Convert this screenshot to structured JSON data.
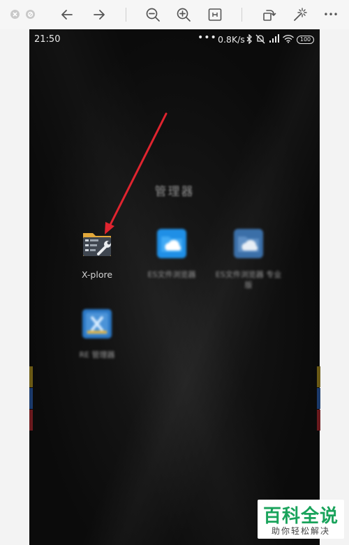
{
  "toolbar": {
    "icons": [
      "close-icon",
      "minimize-icon",
      "back-arrow-icon",
      "forward-arrow-icon",
      "zoom-out-icon",
      "zoom-in-icon",
      "fit-to-window-icon",
      "rotate-icon",
      "magic-wand-icon",
      "more-icon"
    ],
    "more_label": "•••"
  },
  "statusbar": {
    "time": "21:50",
    "more": "•••",
    "speed": "0.8K/s",
    "battery": "100"
  },
  "folder": {
    "title": "管理器",
    "apps": [
      {
        "label": "X-plore",
        "icon": "file-manager-wrench-icon"
      },
      {
        "label": "ES文件浏览器",
        "icon": "cloud-folder-icon"
      },
      {
        "label": "ES文件浏览器 专业版",
        "icon": "cloud-folder-pro-icon"
      },
      {
        "label": "RE 管理器",
        "icon": "re-manager-icon"
      }
    ]
  },
  "watermark": {
    "main": "百科全说",
    "sub": "助你轻松解决"
  },
  "colors": {
    "arrow": "#e0242f",
    "watermark_green": "#19a35b",
    "phone_bg": "#090909"
  }
}
